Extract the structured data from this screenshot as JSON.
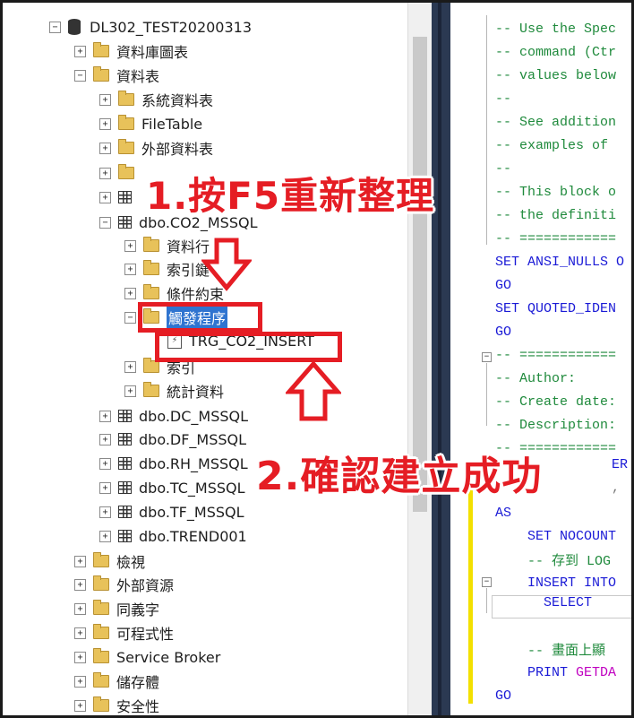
{
  "explorer": {
    "nodes": [
      {
        "id": "db",
        "label": "DL302_TEST20200313",
        "exp": "−",
        "icon": "database-icon"
      },
      {
        "id": "diagrams",
        "label": "資料庫圖表",
        "exp": "+",
        "icon": "folder-icon"
      },
      {
        "id": "tables",
        "label": "資料表",
        "exp": "−",
        "icon": "folder-icon"
      },
      {
        "id": "systables",
        "label": "系統資料表",
        "exp": "+",
        "icon": "folder-icon"
      },
      {
        "id": "filetable",
        "label": "FileTable",
        "exp": "+",
        "icon": "folder-icon"
      },
      {
        "id": "exttables",
        "label": "外部資料表",
        "exp": "+",
        "icon": "folder-icon"
      },
      {
        "id": "hidden1",
        "label": "",
        "exp": "+",
        "icon": "folder-icon"
      },
      {
        "id": "hidden2",
        "label": "",
        "exp": "+",
        "icon": "table-icon"
      },
      {
        "id": "co2",
        "label": "dbo.CO2_MSSQL",
        "exp": "−",
        "icon": "table-icon"
      },
      {
        "id": "columns",
        "label": "資料行",
        "exp": "+",
        "icon": "folder-icon"
      },
      {
        "id": "keys",
        "label": "索引鍵",
        "exp": "+",
        "icon": "folder-icon"
      },
      {
        "id": "constraints",
        "label": "條件約束",
        "exp": "+",
        "icon": "folder-icon"
      },
      {
        "id": "triggers",
        "label": "觸發程序",
        "exp": "−",
        "icon": "folder-icon"
      },
      {
        "id": "trg",
        "label": "TRG_CO2_INSERT",
        "exp": "",
        "icon": "trigger-icon"
      },
      {
        "id": "indexes",
        "label": "索引",
        "exp": "+",
        "icon": "folder-icon"
      },
      {
        "id": "stats",
        "label": "統計資料",
        "exp": "+",
        "icon": "folder-icon"
      },
      {
        "id": "dc",
        "label": "dbo.DC_MSSQL",
        "exp": "+",
        "icon": "table-icon"
      },
      {
        "id": "df",
        "label": "dbo.DF_MSSQL",
        "exp": "+",
        "icon": "table-icon"
      },
      {
        "id": "rh",
        "label": "dbo.RH_MSSQL",
        "exp": "+",
        "icon": "table-icon"
      },
      {
        "id": "tc",
        "label": "dbo.TC_MSSQL",
        "exp": "+",
        "icon": "table-icon"
      },
      {
        "id": "tf",
        "label": "dbo.TF_MSSQL",
        "exp": "+",
        "icon": "table-icon"
      },
      {
        "id": "trend",
        "label": "dbo.TREND001",
        "exp": "+",
        "icon": "table-icon"
      },
      {
        "id": "views",
        "label": "檢視",
        "exp": "+",
        "icon": "folder-icon"
      },
      {
        "id": "extres",
        "label": "外部資源",
        "exp": "+",
        "icon": "folder-icon"
      },
      {
        "id": "synonyms",
        "label": "同義字",
        "exp": "+",
        "icon": "folder-icon"
      },
      {
        "id": "programmability",
        "label": "可程式性",
        "exp": "+",
        "icon": "folder-icon"
      },
      {
        "id": "broker",
        "label": "Service Broker",
        "exp": "+",
        "icon": "folder-icon"
      },
      {
        "id": "storage",
        "label": "儲存體",
        "exp": "+",
        "icon": "folder-icon"
      },
      {
        "id": "security",
        "label": "安全性",
        "exp": "+",
        "icon": "folder-icon"
      }
    ]
  },
  "editor": {
    "lines": [
      {
        "text": "-- Use the Spec",
        "cls": "c"
      },
      {
        "text": "-- command (Ctr",
        "cls": "c"
      },
      {
        "text": "-- values below",
        "cls": "c"
      },
      {
        "text": "--",
        "cls": "c"
      },
      {
        "text": "-- See addition",
        "cls": "c"
      },
      {
        "text": "-- examples of",
        "cls": "c"
      },
      {
        "text": "--",
        "cls": "c"
      },
      {
        "text": "-- This block o",
        "cls": "c"
      },
      {
        "text": "-- the definiti",
        "cls": "c"
      },
      {
        "text": "-- ============",
        "cls": "c"
      },
      {
        "text": "SET ANSI_NULLS O",
        "cls": "k"
      },
      {
        "text": "GO",
        "cls": "k"
      },
      {
        "text": "SET QUOTED_IDEN",
        "cls": "k"
      },
      {
        "text": "GO",
        "cls": "k"
      },
      {
        "text": "-- ============",
        "cls": "c"
      },
      {
        "text": "-- Author:",
        "cls": "c"
      },
      {
        "text": "-- Create date:",
        "cls": "c"
      },
      {
        "text": "-- Description:",
        "cls": "c"
      },
      {
        "text": "-- ============",
        "cls": "c"
      },
      {
        "text": "ER",
        "cls": "k"
      },
      {
        "text": ",",
        "cls": "g"
      },
      {
        "text": "AS",
        "cls": "k"
      },
      {
        "text": "    SET NOCOUNT",
        "cls": "k"
      },
      {
        "text": "    -- 存到 LOG",
        "cls": "c"
      },
      {
        "text": "    INSERT INTO",
        "cls": "k"
      },
      {
        "text": "      SELECT",
        "cls": "k"
      },
      {
        "text": "",
        "cls": "t"
      },
      {
        "text": "    -- 畫面上顯",
        "cls": "c"
      },
      {
        "text": "    PRINT ",
        "cls": "k",
        "extra": "GETDA",
        "extraCls": "m"
      },
      {
        "text": "GO",
        "cls": "k"
      }
    ]
  },
  "annotations": {
    "step1": "1.按F5重新整理",
    "step2": "2.確認建立成功"
  },
  "colors": {
    "annotation": "#e51d24",
    "selection": "#2f74d0",
    "comment": "#1f8a3c",
    "keyword": "#1a1ad6"
  }
}
